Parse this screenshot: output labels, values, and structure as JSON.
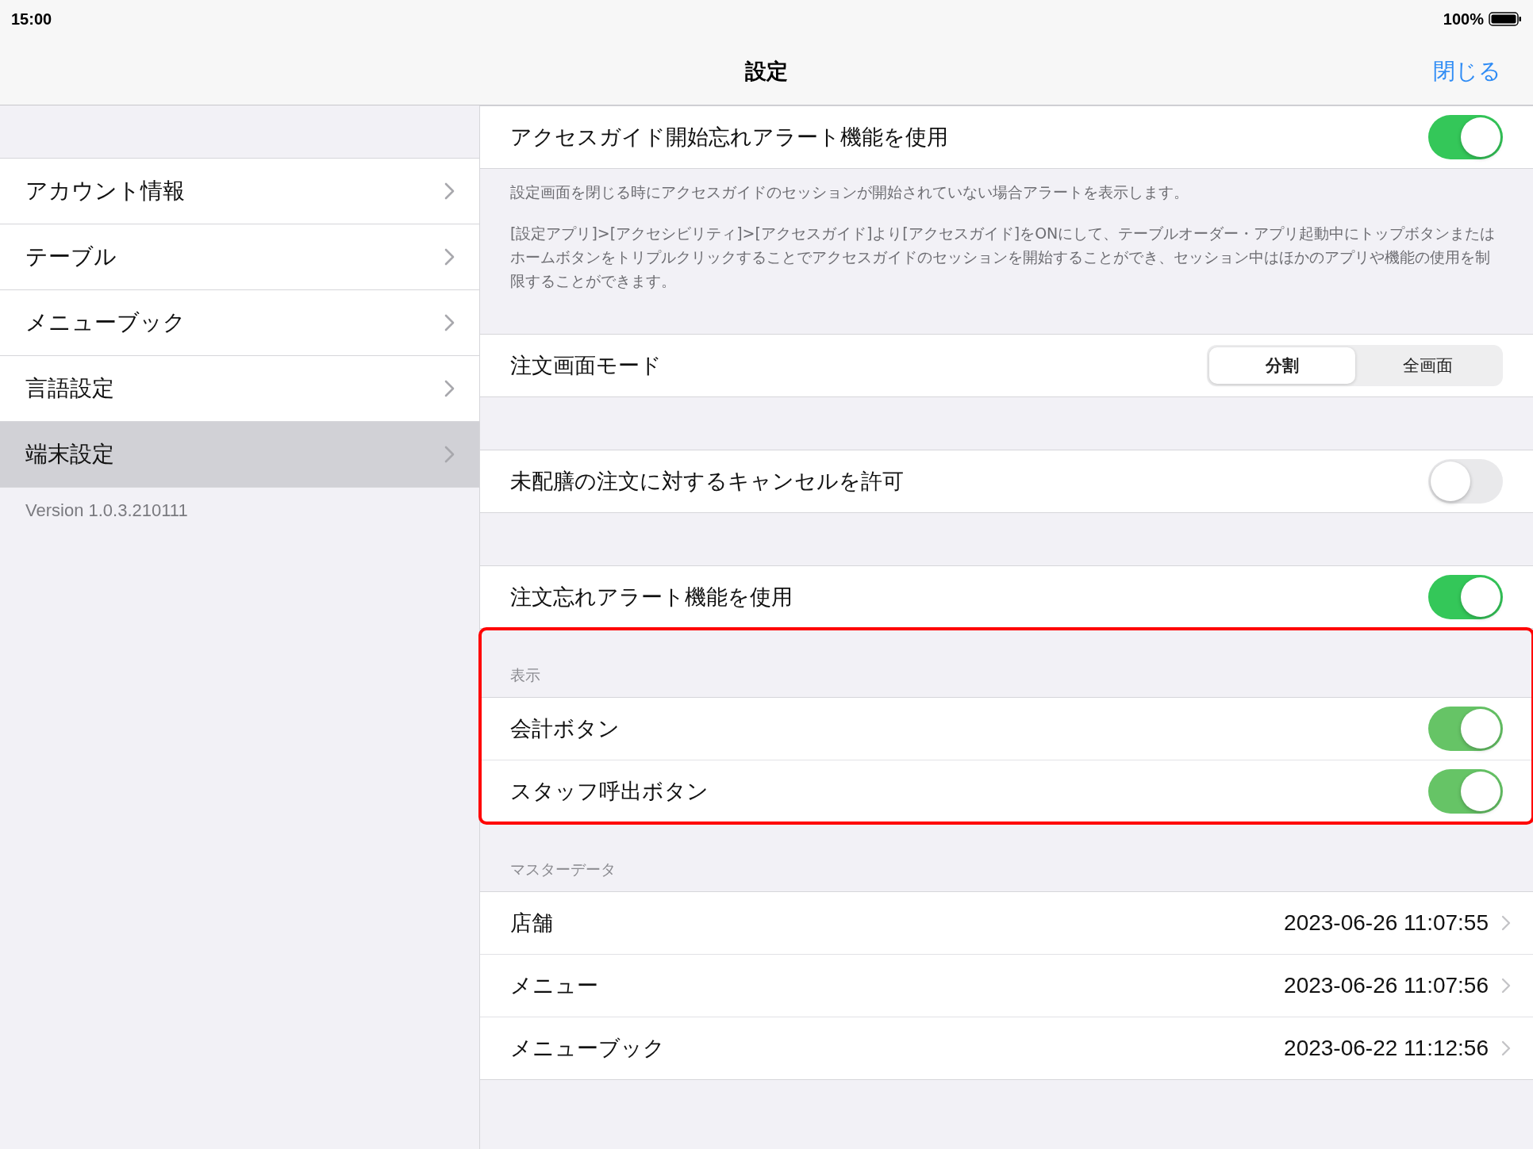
{
  "status_bar": {
    "time": "15:00",
    "battery": "100%"
  },
  "nav_bar": {
    "title": "設定",
    "close": "閉じる"
  },
  "sidebar": {
    "items": [
      {
        "label": "アカウント情報",
        "selected": false
      },
      {
        "label": "テーブル",
        "selected": false
      },
      {
        "label": "メニューブック",
        "selected": false
      },
      {
        "label": "言語設定",
        "selected": false
      },
      {
        "label": "端末設定",
        "selected": true
      }
    ],
    "version": "Version 1.0.3.210111"
  },
  "sections": [
    {
      "highlighted": false,
      "rows": [
        {
          "kind": "toggle",
          "label": "アクセスガイド開始忘れアラート機能を使用",
          "on": true,
          "disabled": false
        }
      ],
      "footer": [
        "設定画面を閉じる時にアクセスガイドのセッションが開始されていない場合アラートを表示します。",
        "[設定アプリ]>[アクセシビリティ]>[アクセスガイド]より[アクセスガイド]をONにして、テーブルオーダー・アプリ起動中にトップボタンまたはホームボタンをトリプルクリックすることでアクセスガイドのセッションを開始することができ、セッション中はほかのアプリや機能の使用を制限することができます。"
      ]
    },
    {
      "highlighted": false,
      "rows": [
        {
          "kind": "segmented",
          "label": "注文画面モード",
          "options": [
            {
              "label": "分割",
              "selected": true
            },
            {
              "label": "全画面",
              "selected": false
            }
          ]
        }
      ]
    },
    {
      "highlighted": false,
      "rows": [
        {
          "kind": "toggle",
          "label": "未配膳の注文に対するキャンセルを許可",
          "on": false,
          "disabled": false
        }
      ]
    },
    {
      "highlighted": false,
      "rows": [
        {
          "kind": "toggle",
          "label": "注文忘れアラート機能を使用",
          "on": true,
          "disabled": false
        }
      ]
    },
    {
      "highlighted": true,
      "header": "表示",
      "rows": [
        {
          "kind": "toggle",
          "label": "会計ボタン",
          "on": true,
          "disabled": true
        },
        {
          "kind": "toggle",
          "label": "スタッフ呼出ボタン",
          "on": true,
          "disabled": true
        }
      ]
    },
    {
      "highlighted": false,
      "header": "マスターデータ",
      "rows": [
        {
          "kind": "detail",
          "label": "店舗",
          "value": "2023-06-26 11:07:55"
        },
        {
          "kind": "detail",
          "label": "メニュー",
          "value": "2023-06-26 11:07:56"
        },
        {
          "kind": "detail",
          "label": "メニューブック",
          "value": "2023-06-22 11:12:56"
        }
      ]
    }
  ]
}
